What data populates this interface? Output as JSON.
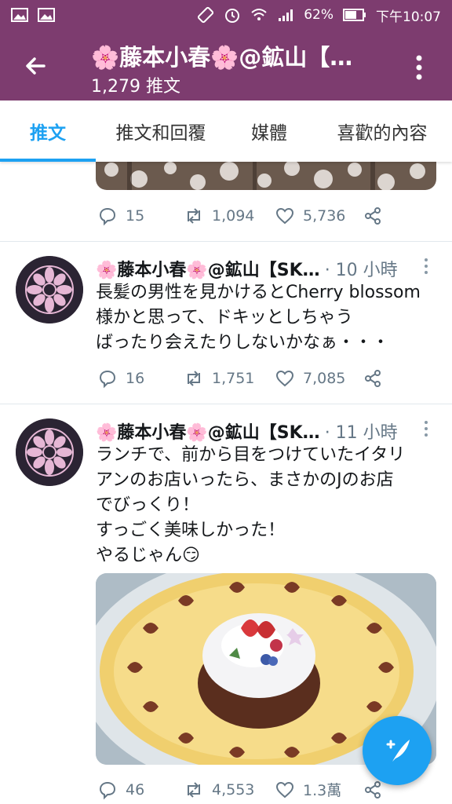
{
  "status_bar": {
    "battery": "62%",
    "time": "下午10:07",
    "icons": [
      "image-icon",
      "image-icon",
      "rotate-icon",
      "alarm-icon",
      "wifi-icon",
      "signal-icon",
      "battery-icon"
    ]
  },
  "header": {
    "title": "🌸藤本小春🌸@鉱山【…",
    "subtitle": "1,279 推文"
  },
  "tabs": [
    {
      "label": "推文",
      "active": true
    },
    {
      "label": "推文和回覆",
      "active": false
    },
    {
      "label": "媒體",
      "active": false
    },
    {
      "label": "喜歡的內容",
      "active": false
    }
  ],
  "tweets": [
    {
      "replies": "15",
      "retweets": "1,094",
      "likes": "5,736"
    },
    {
      "name": "🌸藤本小春🌸@鉱山【SK…",
      "time": "· 10 小時",
      "lines": [
        "長髪の男性を見かけるとCherry blossom",
        "様かと思って、ドキッとしちゃう",
        "ばったり会えたりしないかなぁ・・・"
      ],
      "replies": "16",
      "retweets": "1,751",
      "likes": "7,085"
    },
    {
      "name": "🌸藤本小春🌸@鉱山【SK…",
      "time": "· 11 小時",
      "lines": [
        "ランチで、前から目をつけていたイタリ",
        "アンのお店いったら、まさかのJのお店",
        "でびっくり！",
        "すっごく美味しかった！",
        "やるじゃん😏"
      ],
      "replies": "46",
      "retweets": "4,553",
      "likes": "1.3萬"
    }
  ],
  "colors": {
    "header_bg": "#7d3c6f",
    "accent": "#1da1f2",
    "muted": "#657786"
  }
}
